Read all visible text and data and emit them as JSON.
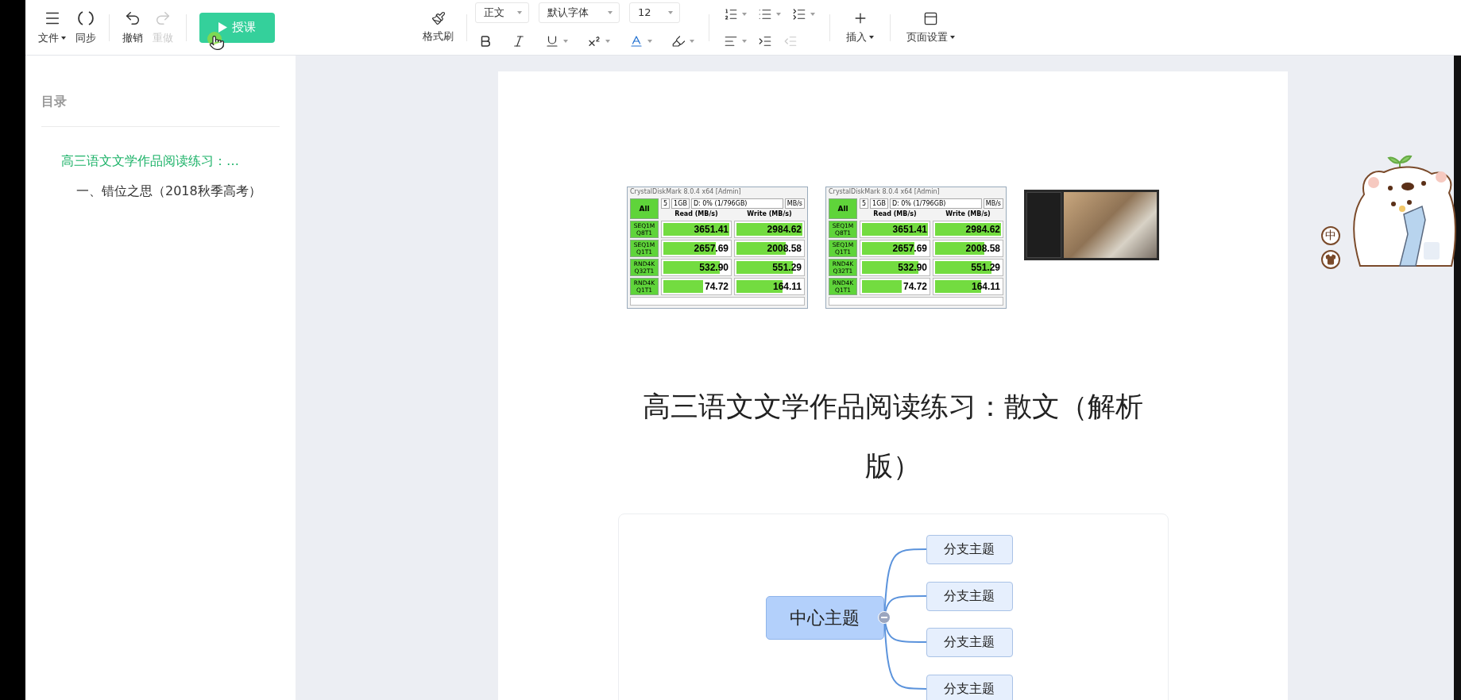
{
  "toolbar": {
    "file_group": [
      {
        "label": "文件",
        "caret": true,
        "disabled": false
      },
      {
        "label": "同步",
        "caret": false,
        "disabled": false
      }
    ],
    "history_group": [
      {
        "label": "撤销",
        "caret": false,
        "disabled": false
      },
      {
        "label": "重做",
        "caret": false,
        "disabled": true
      }
    ],
    "present_button": {
      "label": "授课"
    },
    "format_painter": {
      "label": "格式刷"
    },
    "selects": [
      {
        "value": "正文"
      },
      {
        "value": "默认字体"
      },
      {
        "value": "12"
      }
    ],
    "format_buttons": [
      {
        "caret": false
      },
      {
        "caret": false
      },
      {
        "caret": true
      },
      {
        "caret": true
      },
      {
        "caret": true
      },
      {
        "caret": true
      }
    ],
    "list_buttons": [
      {
        "caret": true,
        "disabled": false
      },
      {
        "caret": true,
        "disabled": false
      },
      {
        "caret": true,
        "disabled": false
      }
    ],
    "indent_buttons": [
      {
        "caret": true,
        "disabled": false
      },
      {
        "caret": false,
        "disabled": false
      },
      {
        "caret": false,
        "disabled": true
      }
    ],
    "insert_menu": {
      "label": "插入",
      "caret": true
    },
    "page_setup_menu": {
      "label": "页面设置",
      "caret": true
    }
  },
  "outline": {
    "title": "目录",
    "items": [
      {
        "label": "高三语文文学作品阅读练习：…",
        "selected": true,
        "children": [
          {
            "label": "一、错位之思（2018秋季高考）",
            "selected": false
          }
        ]
      }
    ]
  },
  "document": {
    "images": [
      {
        "kind": "disk_benchmark",
        "window_title": "CrystalDiskMark 8.0.4 x64 [Admin]",
        "all_button": "All",
        "settings": [
          "5",
          "1GB",
          "D: 0% (1/796GB)",
          "MB/s"
        ],
        "columns": [
          "Read (MB/s)",
          "Write (MB/s)"
        ],
        "rows": [
          {
            "test": "SEQ1M",
            "queue": "Q8T1",
            "read": {
              "value": "3651.41",
              "level": 1
            },
            "write": {
              "value": "2984.62",
              "level": 1
            }
          },
          {
            "test": "SEQ1M",
            "queue": "Q1T1",
            "read": {
              "value": "2657.69",
              "level": 0.8
            },
            "write": {
              "value": "2008.58",
              "level": 0.75
            }
          },
          {
            "test": "RND4K",
            "queue": "Q32T1",
            "read": {
              "value": "532.90",
              "level": 0.85
            },
            "write": {
              "value": "551.29",
              "level": 0.85
            }
          },
          {
            "test": "RND4K",
            "queue": "Q1T1",
            "read": {
              "value": "74.72",
              "level": 0.6
            },
            "write": {
              "value": "164.11",
              "level": 0.7
            }
          }
        ]
      },
      {
        "kind": "disk_benchmark",
        "window_title": "CrystalDiskMark 8.0.4 x64 [Admin]",
        "all_button": "All",
        "settings": [
          "5",
          "1GB",
          "D: 0% (1/796GB)",
          "MB/s"
        ],
        "columns": [
          "Read (MB/s)",
          "Write (MB/s)"
        ],
        "rows": [
          {
            "test": "SEQ1M",
            "queue": "Q8T1",
            "read": {
              "value": "3651.41",
              "level": 1
            },
            "write": {
              "value": "2984.62",
              "level": 1
            }
          },
          {
            "test": "SEQ1M",
            "queue": "Q1T1",
            "read": {
              "value": "2657.69",
              "level": 0.8
            },
            "write": {
              "value": "2008.58",
              "level": 0.75
            }
          },
          {
            "test": "RND4K",
            "queue": "Q32T1",
            "read": {
              "value": "532.90",
              "level": 0.85
            },
            "write": {
              "value": "551.29",
              "level": 0.85
            }
          },
          {
            "test": "RND4K",
            "queue": "Q1T1",
            "read": {
              "value": "74.72",
              "level": 0.6
            },
            "write": {
              "value": "164.11",
              "level": 0.7
            }
          }
        ]
      },
      {
        "kind": "render"
      }
    ],
    "title": "高三语文文学作品阅读练习：散文（解析版）",
    "mindmap": {
      "center": {
        "label": "中心主题",
        "expanded": true
      },
      "branches": [
        {
          "label": "分支主题"
        },
        {
          "label": "分支主题"
        },
        {
          "label": "分支主题"
        },
        {
          "label": "分支主题"
        }
      ]
    }
  },
  "ime_widget": {
    "mode": "中"
  }
}
